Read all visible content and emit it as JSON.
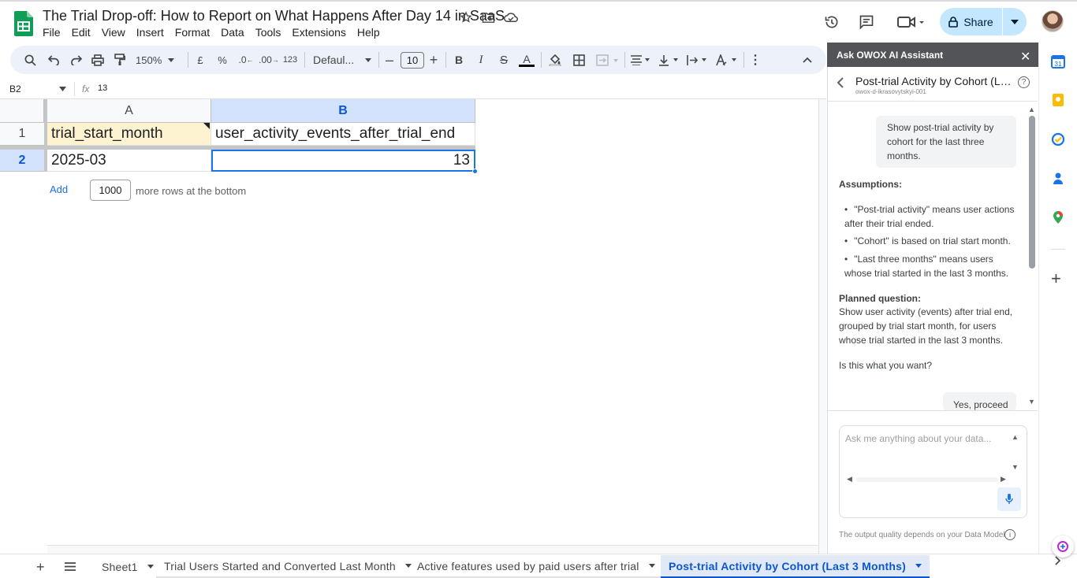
{
  "document": {
    "title": "The Trial Drop-off: How to Report on What Happens After Day 14 in SaaS",
    "menu": [
      "File",
      "Edit",
      "View",
      "Insert",
      "Format",
      "Data",
      "Tools",
      "Extensions",
      "Help"
    ]
  },
  "header": {
    "share_label": "Share"
  },
  "toolbar": {
    "zoom": "150%",
    "currency": "£",
    "percent": "%",
    "decimal_decrease": ".0",
    "decimal_increase": ".00",
    "number_format": "123",
    "font_name": "Defaul...",
    "font_size": "10",
    "bold": "B",
    "italic": "I",
    "strike": "S",
    "text_color_letter": "A"
  },
  "formula_bar": {
    "cell_ref": "B2",
    "fx": "fx",
    "value": "13"
  },
  "grid": {
    "columns": [
      "A",
      "B"
    ],
    "rows": [
      {
        "num": "1",
        "cells": [
          "trial_start_month",
          "user_activity_events_after_trial_end"
        ]
      },
      {
        "num": "2",
        "cells": [
          "2025-03",
          "13"
        ]
      }
    ],
    "add_label": "Add",
    "rows_to_add": "1000",
    "add_suffix": "more rows at the bottom"
  },
  "sheets": [
    {
      "label": "Sheet1",
      "active": false
    },
    {
      "label": "Trial Users Started and Converted Last Month",
      "active": false
    },
    {
      "label": "Active features used by paid users after trial",
      "active": false
    },
    {
      "label": "Post-trial Activity by Cohort (Last 3 Months)",
      "active": true
    }
  ],
  "panel": {
    "title": "Ask OWOX AI Assistant",
    "report_title": "Post-trial Activity by Cohort (Last 3 Months)",
    "report_subtitle": "owox-d-ikrasovytskyi-001",
    "user_message": "Show post-trial activity by cohort for the last three months.",
    "assumptions_heading": "Assumptions:",
    "assumptions": [
      "\"Post-trial activity\" means user actions after their trial ended.",
      "\"Cohort\" is based on trial start month.",
      "\"Last three months\" means users whose trial started in the last 3 months."
    ],
    "planned_heading": "Planned question:",
    "planned_text": "Show user activity (events) after trial end, grouped by trial start month, for users whose trial started in the last 3 months.",
    "question": "Is this what you want?",
    "proceed_label": "Yes, proceed",
    "input_placeholder": "Ask me anything about your data...",
    "footer_note": "The output quality depends on your Data Model"
  },
  "colors": {
    "accent": "#0b57d0",
    "share_bg": "#c2e7ff",
    "header_cell_bg": "#fdf3d1",
    "panel_header_bg": "#525457"
  }
}
